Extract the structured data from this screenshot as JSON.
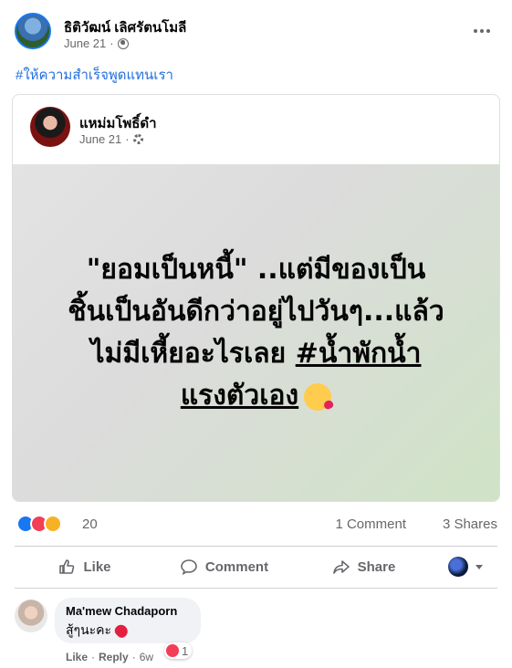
{
  "post": {
    "author": "ธิติวัฒน์ เลิศรัตนโมลี",
    "date": "June 21",
    "separator": "·",
    "hashtag": "#ให้ความสำเร็จพูดแทนเรา"
  },
  "shared": {
    "author": "แหม่มโพธิ์ดำ",
    "date": "June 21",
    "separator": "·",
    "text_line1": "\"ยอมเป็นหนี้\" ..แต่มีของเป็น",
    "text_line2": "ชิ้นเป็นอันดีกว่าอยู่ไปวันๆ...แล้ว",
    "text_line3": "ไม่มีเหี้ยอะไรเลย",
    "tag1": "#น้ำพักน้ำ",
    "tag2": "แรงตัวเอง"
  },
  "reactions": {
    "count": "20",
    "comments": "1 Comment",
    "shares": "3 Shares"
  },
  "actions": {
    "like": "Like",
    "comment": "Comment",
    "share": "Share"
  },
  "comment": {
    "author": "Ma'mew Chadaporn",
    "text": "สู้ๆนะคะ",
    "react_count": "1",
    "like": "Like",
    "reply": "Reply",
    "dot": "·",
    "age": "6w"
  }
}
